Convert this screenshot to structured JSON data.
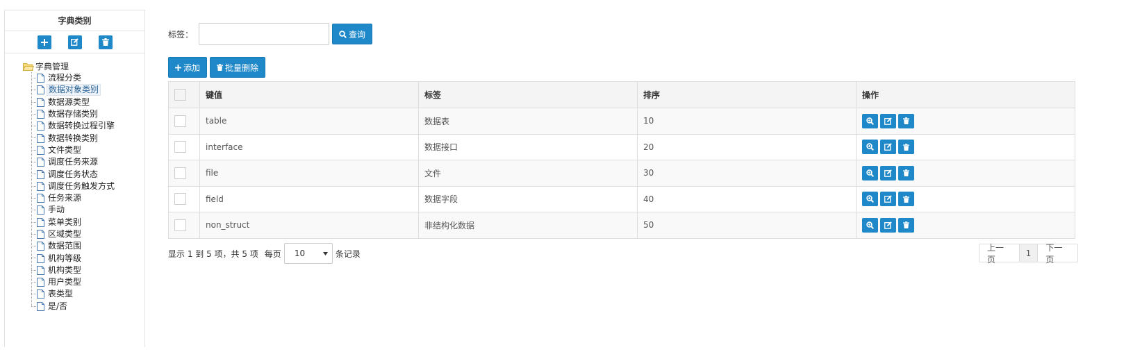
{
  "sidebar": {
    "title": "字典类别",
    "tools": [
      "add-icon",
      "edit-icon",
      "delete-icon"
    ],
    "tree": {
      "root": "字典管理",
      "selected_index": 1,
      "items": [
        "流程分类",
        "数据对象类别",
        "数据源类型",
        "数据存储类别",
        "数据转换过程引擎",
        "数据转换类别",
        "文件类型",
        "调度任务来源",
        "调度任务状态",
        "调度任务触发方式",
        "任务来源",
        "手动",
        "菜单类别",
        "区域类型",
        "数据范围",
        "机构等级",
        "机构类型",
        "用户类型",
        "表类型",
        "是/否"
      ]
    }
  },
  "search": {
    "label": "标签：",
    "value": "",
    "placeholder": "",
    "button": "查询"
  },
  "actions": {
    "add": "添加",
    "batch_delete": "批量删除"
  },
  "table": {
    "headers": [
      "键值",
      "标签",
      "排序",
      "操作"
    ],
    "rows": [
      {
        "key": "table",
        "label": "数据表",
        "sort": "10"
      },
      {
        "key": "interface",
        "label": "数据接口",
        "sort": "20"
      },
      {
        "key": "file",
        "label": "文件",
        "sort": "30"
      },
      {
        "key": "field",
        "label": "数据字段",
        "sort": "40"
      },
      {
        "key": "non_struct",
        "label": "非结构化数据",
        "sort": "50"
      }
    ]
  },
  "footer": {
    "summary": "显示 1 到 5 项，共 5 项",
    "per_page_prefix": "每页",
    "page_size": "10",
    "per_page_suffix": "条记录",
    "prev": "上一页",
    "current": "1",
    "next": "下一页"
  },
  "colors": {
    "accent": "#1f88c9",
    "border": "#dddddd",
    "header_bg": "#f4f4f4"
  }
}
